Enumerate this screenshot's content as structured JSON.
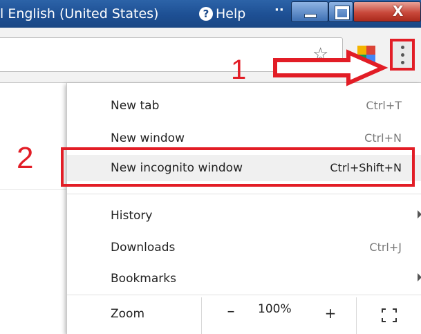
{
  "titlebar": {
    "language": "l English (United States)",
    "help_label": "Help",
    "help_icon": "?",
    "window_controls": {
      "minimize": "minimize-icon",
      "maximize": "maximize-icon",
      "close_glyph": "X"
    }
  },
  "toolbar": {
    "bookmark_icon": "star-icon",
    "menu_icon": "kebab-menu-icon"
  },
  "menu": {
    "items": [
      {
        "label": "New tab",
        "shortcut": "Ctrl+T"
      },
      {
        "label": "New window",
        "shortcut": "Ctrl+N"
      },
      {
        "label": "New incognito window",
        "shortcut": "Ctrl+Shift+N"
      },
      {
        "label": "History",
        "shortcut": ""
      },
      {
        "label": "Downloads",
        "shortcut": "Ctrl+J"
      },
      {
        "label": "Bookmarks",
        "shortcut": ""
      }
    ],
    "zoom": {
      "label": "Zoom",
      "minus": "–",
      "value": "100%",
      "plus": "+"
    }
  },
  "annotations": {
    "step1": "1",
    "step2": "2",
    "color": "#e21d26"
  }
}
